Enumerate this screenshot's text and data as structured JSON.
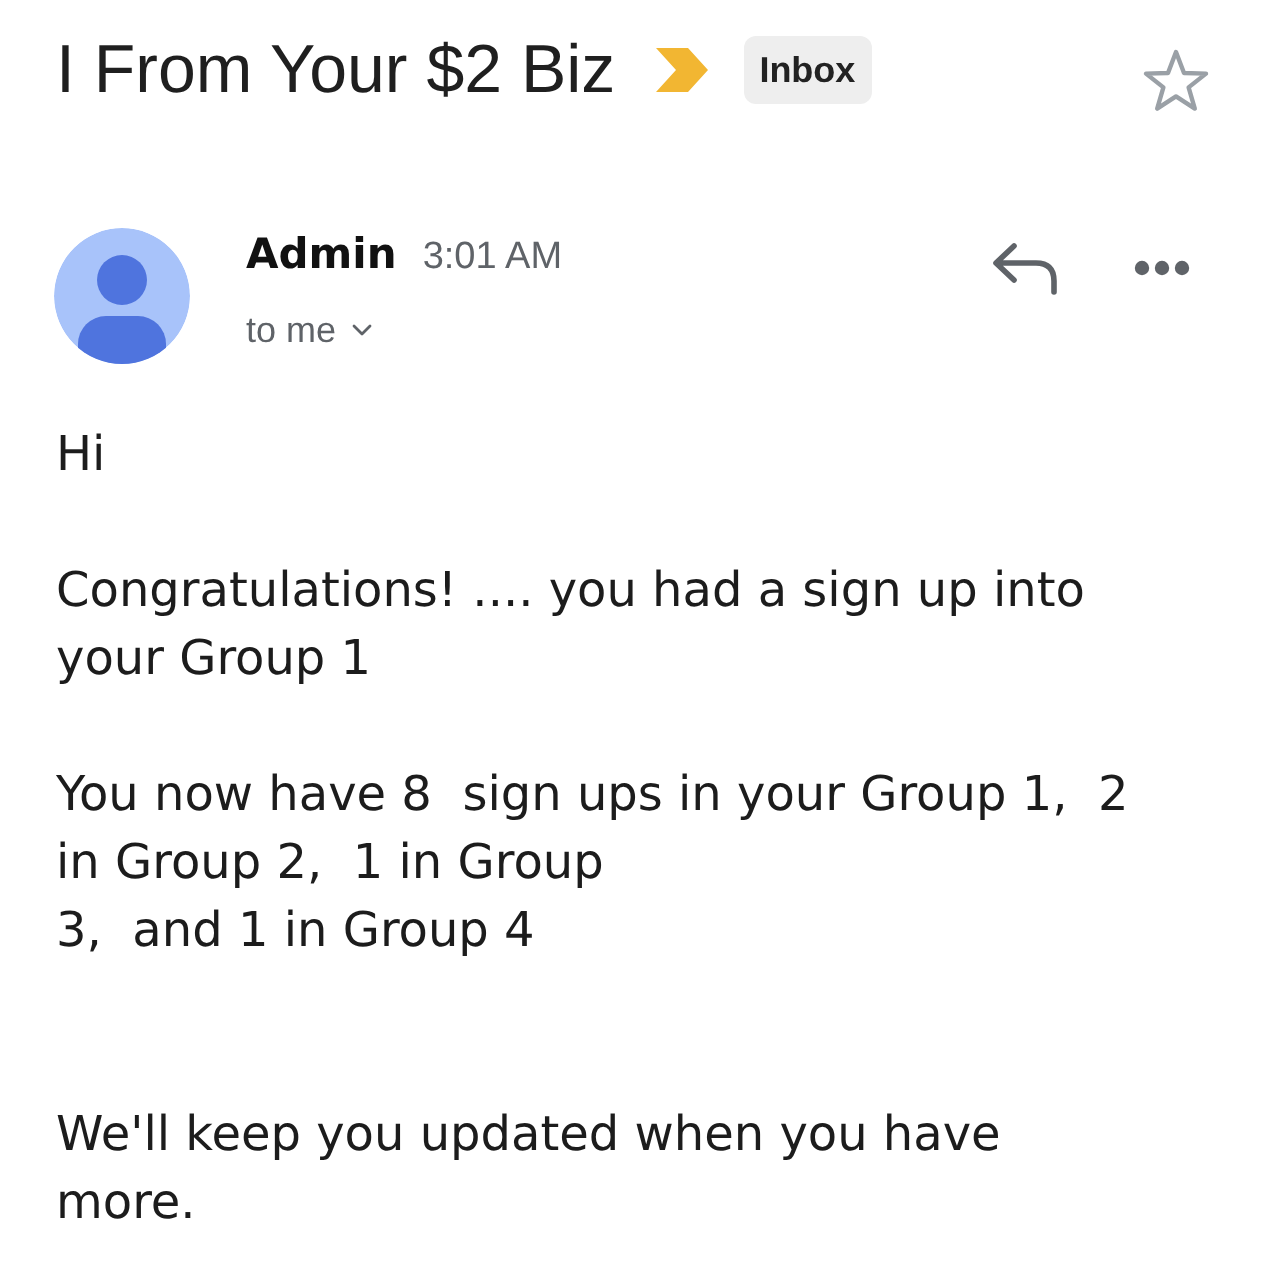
{
  "subject": {
    "text": "I From Your $2 Biz",
    "important": true,
    "label": "Inbox",
    "starred": false
  },
  "message": {
    "sender": "Admin",
    "time": "3:01 AM",
    "recipient": "to me"
  },
  "body": {
    "paragraphs": [
      "Hi",
      "Congratulations! .... you had a sign up into\nyour Group 1",
      "You now have 8  sign ups in your Group 1,  2\nin Group 2,  1 in Group\n3,  and 1 in Group 4",
      "We'll keep you updated when you have\nmore."
    ]
  }
}
